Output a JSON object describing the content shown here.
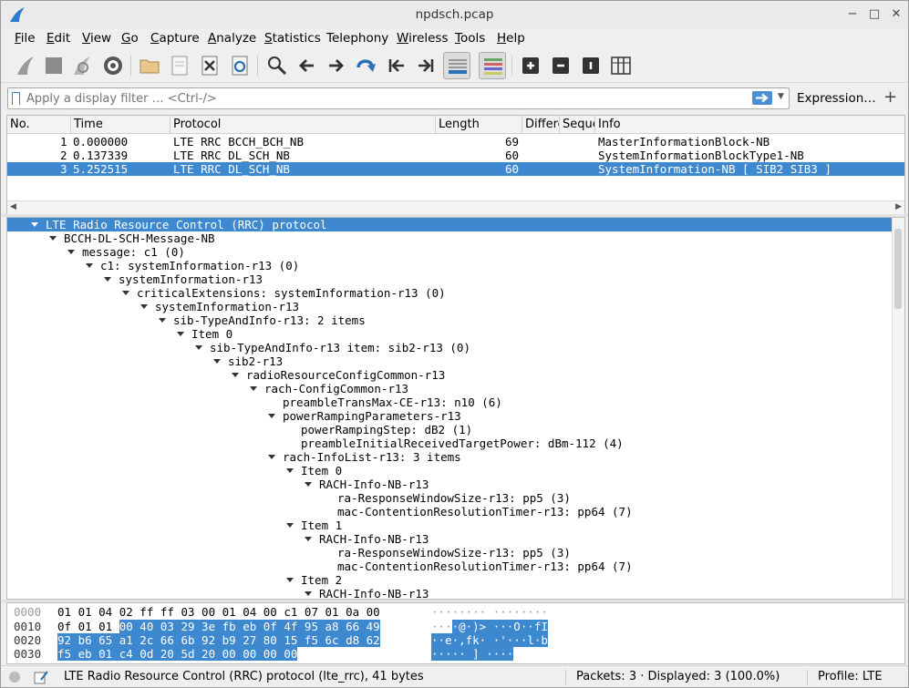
{
  "window": {
    "title": "npdsch.pcap"
  },
  "menu": [
    {
      "label": "File",
      "u": "F",
      "rest": "ile"
    },
    {
      "label": "Edit",
      "u": "E",
      "rest": "dit"
    },
    {
      "label": "View",
      "u": "V",
      "rest": "iew"
    },
    {
      "label": "Go",
      "u": "G",
      "rest": "o"
    },
    {
      "label": "Capture",
      "u": "C",
      "rest": "apture"
    },
    {
      "label": "Analyze",
      "u": "A",
      "rest": "nalyze"
    },
    {
      "label": "Statistics",
      "u": "S",
      "rest": "tatistics"
    },
    {
      "label": "Telephony",
      "u": "",
      "rest": "Telephony"
    },
    {
      "label": "Wireless",
      "u": "W",
      "rest": "ireless"
    },
    {
      "label": "Tools",
      "u": "T",
      "rest": "ools"
    },
    {
      "label": "Help",
      "u": "H",
      "rest": "elp"
    }
  ],
  "toolbar_icons": [
    "start-capture-icon",
    "stop-capture-icon",
    "restart-capture-icon",
    "capture-options-icon",
    "open-file-icon",
    "save-file-icon",
    "close-file-icon",
    "reload-file-icon",
    "find-packet-icon",
    "go-back-icon",
    "go-forward-icon",
    "go-to-packet-icon",
    "first-packet-icon",
    "last-packet-icon",
    "auto-scroll-icon",
    "colorize-icon",
    "zoom-in-icon",
    "zoom-out-icon",
    "normal-size-icon",
    "resize-columns-icon"
  ],
  "filter": {
    "placeholder": "Apply a display filter … <Ctrl-/>",
    "expression_label": "Expression…",
    "add_label": "+"
  },
  "columns": [
    "No.",
    "Time",
    "Protocol",
    "Length",
    "Differe",
    "Seque",
    "Info"
  ],
  "packets": [
    {
      "no": "1",
      "time": "0.000000",
      "protocol": "LTE RRC BCCH_BCH_NB",
      "length": "69",
      "info": "MasterInformationBlock-NB",
      "selected": false
    },
    {
      "no": "2",
      "time": "0.137339",
      "protocol": "LTE RRC DL_SCH_NB",
      "length": "60",
      "info": "SystemInformationBlockType1-NB",
      "selected": false
    },
    {
      "no": "3",
      "time": "5.252515",
      "protocol": "LTE RRC DL_SCH_NB",
      "length": "60",
      "info": "SystemInformation-NB [ SIB2 SIB3 ]",
      "selected": true
    }
  ],
  "tree": [
    {
      "depth": 0,
      "exp": true,
      "text": "LTE Radio Resource Control (RRC) protocol",
      "selected": true
    },
    {
      "depth": 1,
      "exp": true,
      "text": "BCCH-DL-SCH-Message-NB"
    },
    {
      "depth": 2,
      "exp": true,
      "text": "message: c1 (0)"
    },
    {
      "depth": 3,
      "exp": true,
      "text": "c1: systemInformation-r13 (0)"
    },
    {
      "depth": 4,
      "exp": true,
      "text": "systemInformation-r13"
    },
    {
      "depth": 5,
      "exp": true,
      "text": "criticalExtensions: systemInformation-r13 (0)"
    },
    {
      "depth": 6,
      "exp": true,
      "text": "systemInformation-r13"
    },
    {
      "depth": 7,
      "exp": true,
      "text": "sib-TypeAndInfo-r13: 2 items"
    },
    {
      "depth": 8,
      "exp": true,
      "text": "Item 0"
    },
    {
      "depth": 9,
      "exp": true,
      "text": "sib-TypeAndInfo-r13 item: sib2-r13 (0)"
    },
    {
      "depth": 10,
      "exp": true,
      "text": "sib2-r13"
    },
    {
      "depth": 11,
      "exp": true,
      "text": "radioResourceConfigCommon-r13"
    },
    {
      "depth": 12,
      "exp": true,
      "text": "rach-ConfigCommon-r13"
    },
    {
      "depth": 13,
      "exp": false,
      "text": "preambleTransMax-CE-r13: n10 (6)"
    },
    {
      "depth": 13,
      "exp": true,
      "text": "powerRampingParameters-r13"
    },
    {
      "depth": 14,
      "exp": false,
      "text": "powerRampingStep: dB2 (1)"
    },
    {
      "depth": 14,
      "exp": false,
      "text": "preambleInitialReceivedTargetPower: dBm-112 (4)"
    },
    {
      "depth": 13,
      "exp": true,
      "text": "rach-InfoList-r13: 3 items"
    },
    {
      "depth": 14,
      "exp": true,
      "text": "Item 0"
    },
    {
      "depth": 15,
      "exp": true,
      "text": "RACH-Info-NB-r13"
    },
    {
      "depth": 16,
      "exp": false,
      "text": "ra-ResponseWindowSize-r13: pp5 (3)"
    },
    {
      "depth": 16,
      "exp": false,
      "text": "mac-ContentionResolutionTimer-r13: pp64 (7)"
    },
    {
      "depth": 14,
      "exp": true,
      "text": "Item 1"
    },
    {
      "depth": 15,
      "exp": true,
      "text": "RACH-Info-NB-r13"
    },
    {
      "depth": 16,
      "exp": false,
      "text": "ra-ResponseWindowSize-r13: pp5 (3)"
    },
    {
      "depth": 16,
      "exp": false,
      "text": "mac-ContentionResolutionTimer-r13: pp64 (7)"
    },
    {
      "depth": 14,
      "exp": true,
      "text": "Item 2"
    },
    {
      "depth": 15,
      "exp": true,
      "text": "RACH-Info-NB-r13"
    }
  ],
  "hex": [
    {
      "offset": "0000",
      "hex_plain": "01 01 04 02 ff ff 03 00  01 04 00 c1 07 01 0a 00",
      "hex_hl": "",
      "ascii_plain": "········ ········",
      "ascii_hl": ""
    },
    {
      "offset": "0010",
      "hex_plain": "0f 01 01 ",
      "hex_hl": "00 40 03 29 3e  fb eb 0f 4f 95 a8 66 49",
      "ascii_plain": "···",
      "ascii_hl": "·@·)> ···O··fI"
    },
    {
      "offset": "0020",
      "hex_plain": "",
      "hex_hl": "92 b6 65 a1 2c 66 6b 92  b9 27 80 15 f5 6c d8 62",
      "ascii_plain": "",
      "ascii_hl": "··e·,fk· ·'···l·b"
    },
    {
      "offset": "0030",
      "hex_plain": "",
      "hex_hl": "f5 eb 01 c4 0d 20 5d 20  00 00 00 00",
      "ascii_plain": "",
      "ascii_hl": "····· ] ····"
    }
  ],
  "status": {
    "protocol_text": "LTE Radio Resource Control (RRC) protocol (lte_rrc), 41 bytes",
    "packets_text": "Packets: 3 · Displayed: 3 (100.0%)",
    "profile_text": "Profile: LTE"
  }
}
